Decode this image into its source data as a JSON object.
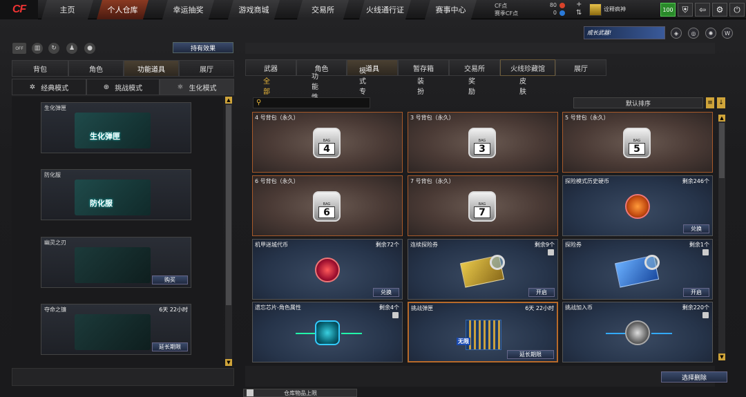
{
  "topnav": [
    "主页",
    "个人仓库",
    "幸运抽奖",
    "游戏商城",
    "交易所",
    "火线通行证",
    "赛事中心"
  ],
  "topnav_active": 1,
  "logo": "CF",
  "currency": [
    {
      "label": "CF点",
      "value": "80",
      "color": "#d9432a"
    },
    {
      "label": "赛季CF点",
      "value": "0",
      "color": "#2a7ad9"
    }
  ],
  "rank_name": "诠释疯神",
  "level": "100",
  "top_buttons": [
    "shield-icon",
    "exit-icon",
    "gear-icon",
    "power-icon"
  ],
  "left": {
    "status_icons": [
      "OFF",
      "bar-chart-icon",
      "refresh-icon",
      "figure-icon",
      "bag-icon"
    ],
    "effect_button": "持有效果",
    "tabs": [
      "背包",
      "角色",
      "功能道具",
      "展厅"
    ],
    "tabs_active": 2,
    "modes": [
      "经典模式",
      "挑战模式",
      "生化模式"
    ],
    "modes_active": 2,
    "items": [
      {
        "name": "生化弹匣",
        "pic_text": "生化弹匣",
        "time": "",
        "action": ""
      },
      {
        "name": "防化服",
        "pic_text": "防化服",
        "time": "",
        "action": ""
      },
      {
        "name": "幽灵之刃",
        "pic_text": "",
        "time": "",
        "action": "购买"
      },
      {
        "name": "夺命之镰",
        "pic_text": "",
        "time": "6天 22小时",
        "action": "延长期限"
      }
    ]
  },
  "right": {
    "promo": "成长武器!",
    "promo_icons": [
      "shield-badge-icon",
      "target-badge-icon",
      "swirl-badge-icon",
      "w-badge-icon"
    ],
    "tabs": [
      "武器",
      "角色",
      "道具",
      "暂存箱",
      "交易所",
      "火线珍藏馆",
      "展厅"
    ],
    "tabs_active": 2,
    "subtabs": [
      "全部",
      "功能性",
      "模式专属",
      "装扮",
      "奖励",
      "皮肤"
    ],
    "subtabs_active": 0,
    "search_placeholder": "",
    "sort_label": "默认排序",
    "cards": [
      {
        "name": "4 号背包（永久）",
        "kind": "bag",
        "num": "4",
        "tag": "BAG",
        "remain": "",
        "action": ""
      },
      {
        "name": "3 号背包（永久）",
        "kind": "bag",
        "num": "3",
        "tag": "BAG",
        "remain": "",
        "action": ""
      },
      {
        "name": "5 号背包（永久）",
        "kind": "bag",
        "num": "5",
        "tag": "BAG",
        "remain": "",
        "action": ""
      },
      {
        "name": "6 号背包（永久）",
        "kind": "bag",
        "num": "6",
        "tag": "BAG",
        "remain": "",
        "action": ""
      },
      {
        "name": "7 号背包（永久）",
        "kind": "bag",
        "num": "7",
        "tag": "BAG",
        "remain": "",
        "action": ""
      },
      {
        "name": "探险模式历史硬币",
        "kind": "coin",
        "icon": "orange-orb",
        "remain": "剩余246个",
        "action": "兑换"
      },
      {
        "name": "机甲迷城代币",
        "kind": "coin",
        "icon": "red-orb",
        "remain": "剩余72个",
        "action": "兑换"
      },
      {
        "name": "连续探险券",
        "kind": "coin",
        "icon": "gold-map",
        "remain": "剩余9个",
        "action": "开启"
      },
      {
        "name": "探险券",
        "kind": "coin",
        "icon": "blue-map",
        "remain": "剩余1个",
        "action": "开启"
      },
      {
        "name": "遗忘芯片-角色属性",
        "kind": "coin",
        "icon": "teal-chip",
        "remain": "剩余4个",
        "action": ""
      },
      {
        "name": "挑战弹匣",
        "kind": "coin",
        "icon": "ammo",
        "ammo_label": "无限",
        "remain": "6天 22小时",
        "action": "延长期限"
      },
      {
        "name": "挑战加入币",
        "kind": "coin",
        "icon": "grey-coin",
        "remain": "剩余220个",
        "action": ""
      }
    ],
    "bulk_delete": "选择删除",
    "capacity_label": "仓库物品上限"
  }
}
